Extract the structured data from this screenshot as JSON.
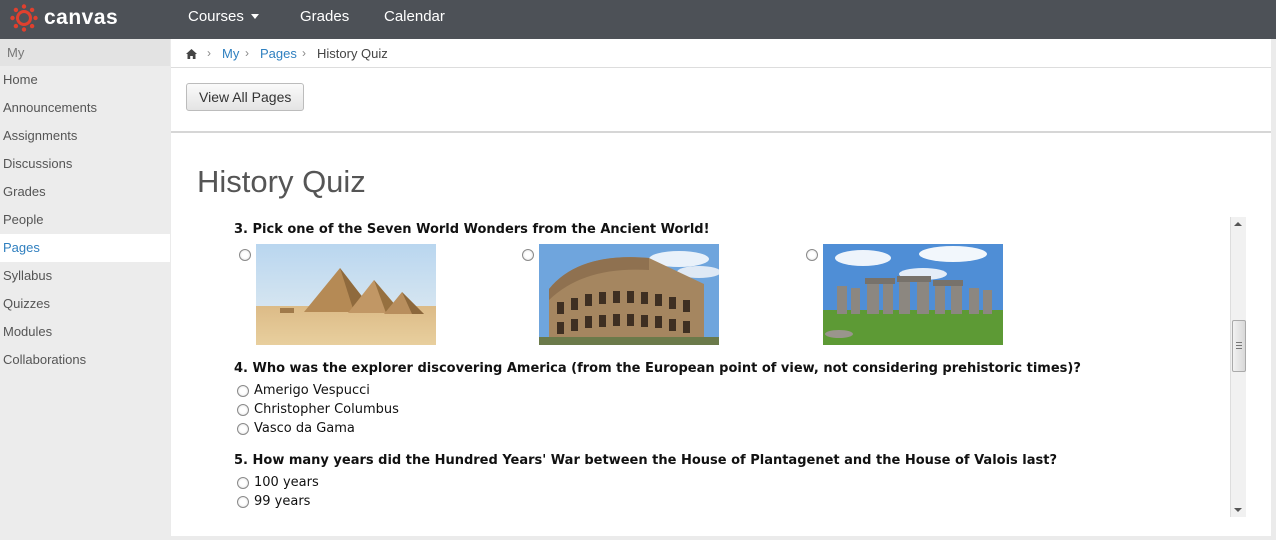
{
  "header": {
    "brand": "canvas",
    "nav": [
      {
        "label": "Courses"
      },
      {
        "label": "Grades"
      },
      {
        "label": "Calendar"
      }
    ]
  },
  "sidebar": {
    "title": "My",
    "items": [
      {
        "label": "Home"
      },
      {
        "label": "Announcements"
      },
      {
        "label": "Assignments"
      },
      {
        "label": "Discussions"
      },
      {
        "label": "Grades"
      },
      {
        "label": "People"
      },
      {
        "label": "Pages"
      },
      {
        "label": "Syllabus"
      },
      {
        "label": "Quizzes"
      },
      {
        "label": "Modules"
      },
      {
        "label": "Collaborations"
      }
    ],
    "active": "Pages"
  },
  "breadcrumb": {
    "home_icon": "home-icon",
    "items": [
      "My",
      "Pages",
      "History Quiz"
    ]
  },
  "toolbar": {
    "view_all_label": "View All Pages"
  },
  "page": {
    "title": "History Quiz"
  },
  "quiz": {
    "q3": {
      "text": "3. Pick one of the Seven World Wonders from the Ancient World!",
      "image_options": [
        "pyramids-image",
        "colosseum-image",
        "stonehenge-image"
      ]
    },
    "q4": {
      "text": "4. Who was the explorer discovering America (from the European point of view, not considering prehistoric times)?",
      "options": [
        "Amerigo Vespucci",
        "Christopher Columbus",
        "Vasco da Gama"
      ]
    },
    "q5": {
      "text": "5. How many years did the Hundred Years' War between the House of Plantagenet and the House of Valois last?",
      "options": [
        "100 years",
        "99 years"
      ]
    }
  },
  "colors": {
    "header_bg": "#4d5157",
    "brand_red": "#e0402e",
    "link_blue": "#2f80c0",
    "sidebar_bg": "#ececec"
  }
}
